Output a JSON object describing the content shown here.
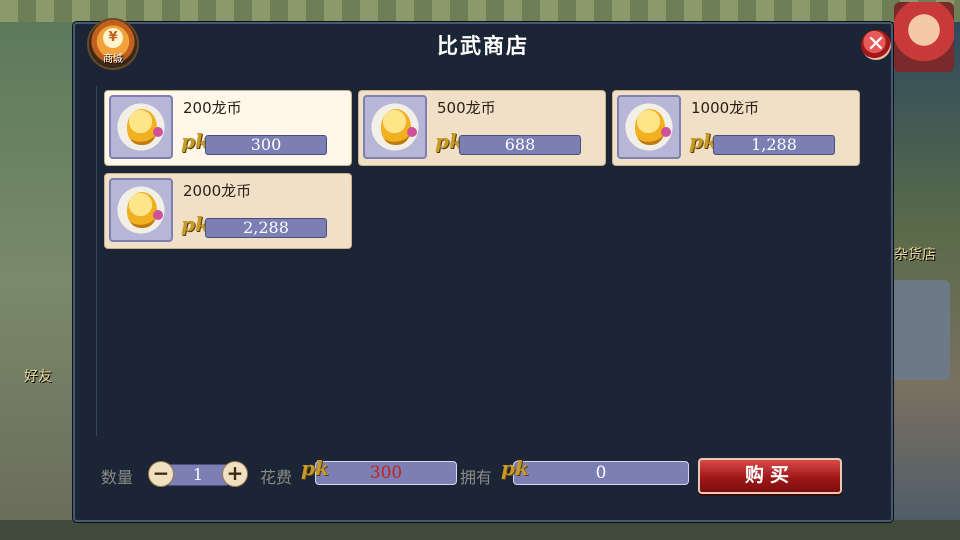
{
  "background": {
    "left_label": "好友",
    "right_label": "杂货店"
  },
  "dialog": {
    "title": "比武商店",
    "shop_badge_label": "商城",
    "shop_badge_symbol": "¥",
    "close_symbol": "✕"
  },
  "currency": {
    "symbol": "pk"
  },
  "items": [
    {
      "name": "200龙币",
      "price": "300",
      "selected": true
    },
    {
      "name": "500龙币",
      "price": "688",
      "selected": false
    },
    {
      "name": "1000龙币",
      "price": "1,288",
      "selected": false
    },
    {
      "name": "2000龙币",
      "price": "2,288",
      "selected": false
    }
  ],
  "footer": {
    "quantity_label": "数量",
    "quantity_value": "1",
    "minus_symbol": "−",
    "plus_symbol": "+",
    "cost_label": "花费",
    "cost_value": "300",
    "owned_label": "拥有",
    "owned_value": "0",
    "buy_label": "购买"
  },
  "colors": {
    "dialog_bg": "#1b2535",
    "item_bg": "#efe0c7",
    "price_bar": "#7b7fb3",
    "cost_text": "#c82020",
    "buy_button": "#a01818"
  }
}
